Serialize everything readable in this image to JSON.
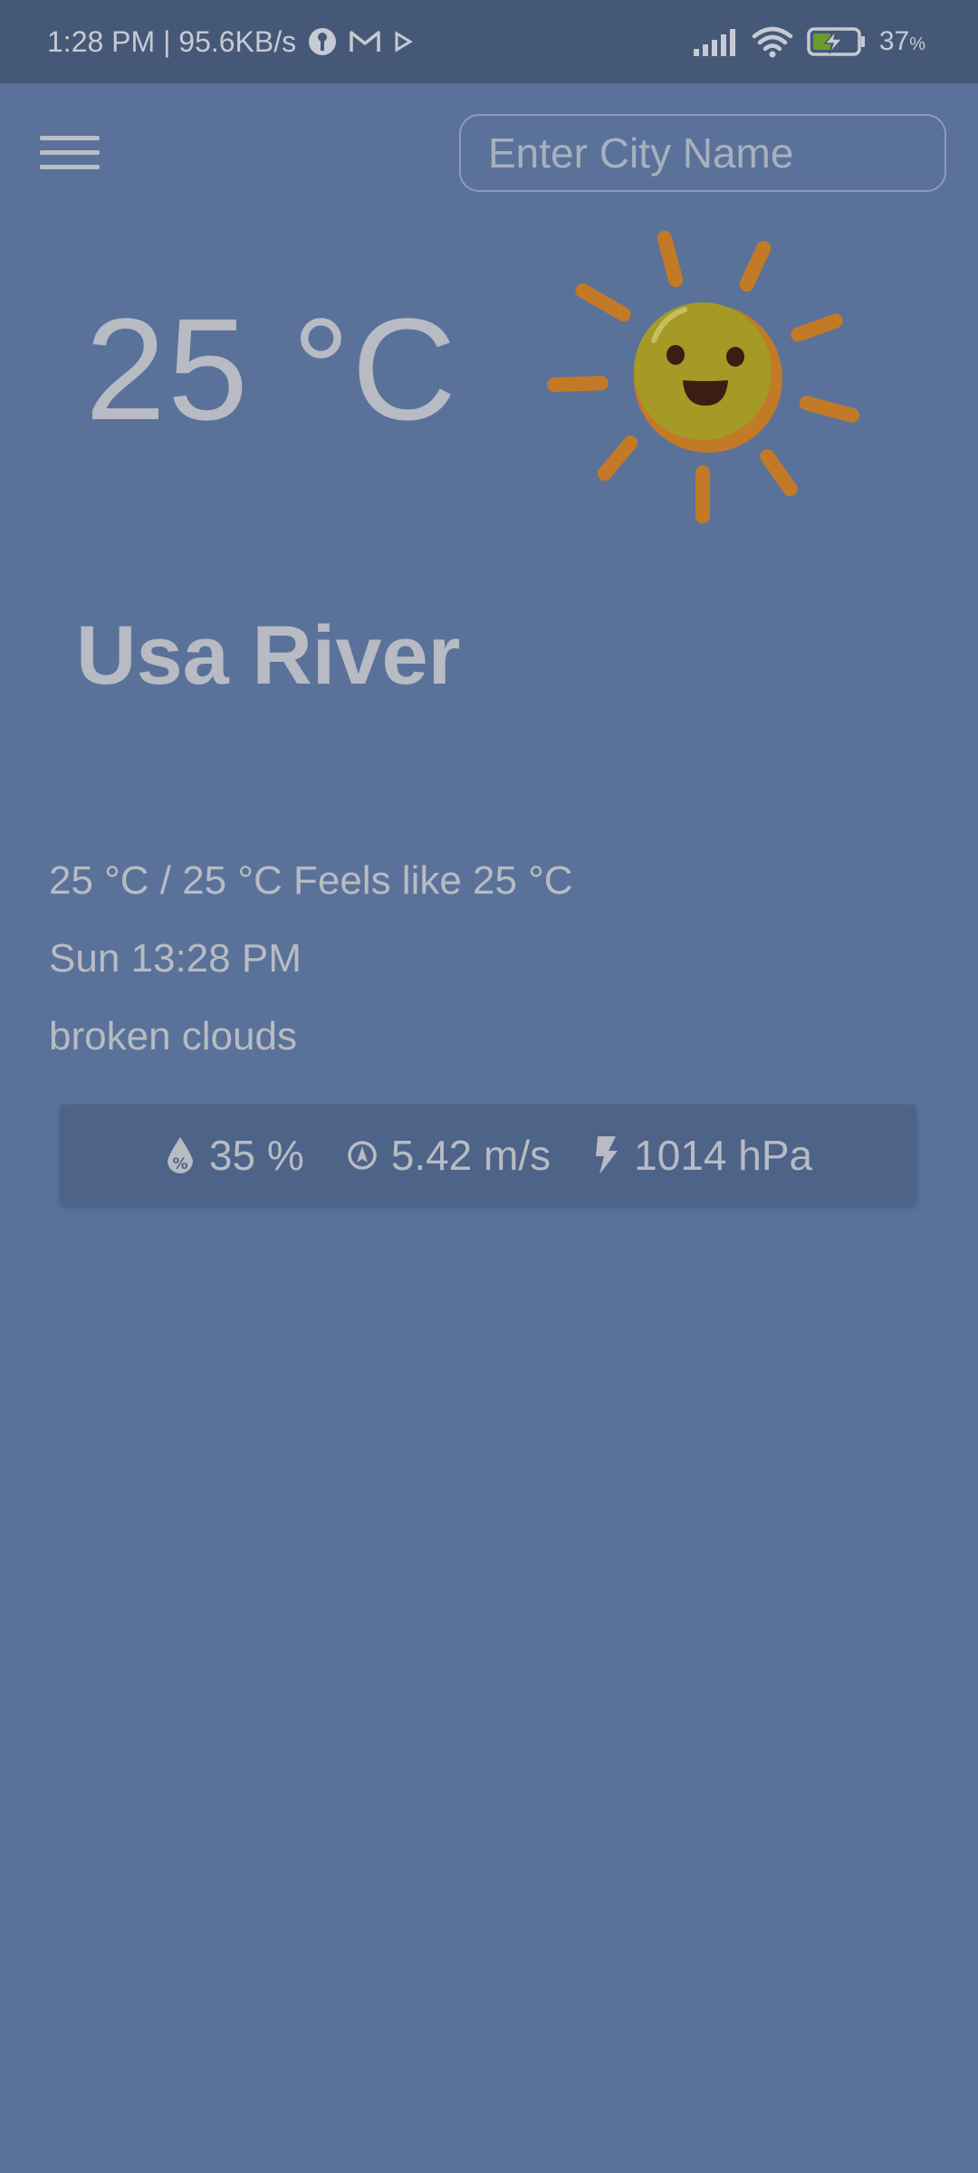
{
  "status_bar": {
    "time_info": "1:28 PM | 95.6KB/s",
    "icons_left": [
      "vpn-key-icon",
      "gmail-icon",
      "play-icon"
    ],
    "icons_right": [
      "signal-icon",
      "wifi-icon",
      "battery-charging-icon"
    ],
    "battery_value": "37",
    "battery_unit": "%"
  },
  "header": {
    "menu_icon": "hamburger-menu-icon",
    "search_placeholder": "Enter City Name",
    "search_value": ""
  },
  "weather": {
    "temperature": "25 °C",
    "icon": "smiling-sun-icon",
    "city": "Usa River",
    "min_max_feels": "25 °C / 25 °C Feels like 25 °C",
    "datetime": "Sun 13:28 PM",
    "description": "broken clouds"
  },
  "stats": {
    "humidity": "35 %",
    "humidity_icon": "humidity-drop-icon",
    "wind": "5.42 m/s",
    "wind_icon": "wind-direction-icon",
    "pressure": "1014 hPa",
    "pressure_icon": "lightning-icon"
  },
  "colors": {
    "background": "#5a7299",
    "status_bar": "#455878",
    "card": "#4e6388",
    "text": "#b8bbc3",
    "sun_body": "#a59a25",
    "sun_rays": "#c37a26"
  }
}
